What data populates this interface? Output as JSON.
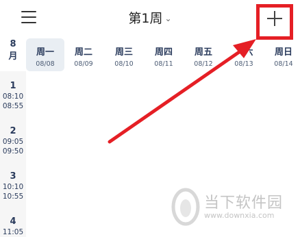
{
  "header": {
    "week_label": "第1周",
    "caret": "⌄",
    "menu_icon": "hamburger-menu-icon",
    "add_icon": "plus-icon",
    "highlight_color": "#e51f25"
  },
  "month": {
    "number": "8",
    "unit": "月"
  },
  "days": [
    {
      "name": "周一",
      "date": "08/08",
      "active": true
    },
    {
      "name": "周二",
      "date": "08/09",
      "active": false
    },
    {
      "name": "周三",
      "date": "08/10",
      "active": false
    },
    {
      "name": "周四",
      "date": "08/11",
      "active": false
    },
    {
      "name": "周五",
      "date": "08/12",
      "active": false
    },
    {
      "name": "六",
      "date": "08/13",
      "active": false
    },
    {
      "name": "周日",
      "date": "08/14",
      "active": false
    }
  ],
  "periods": [
    {
      "num": "1",
      "start": "08:10",
      "end": "08:55"
    },
    {
      "num": "2",
      "start": "09:05",
      "end": "09:50"
    },
    {
      "num": "3",
      "start": "10:10",
      "end": "10:55"
    },
    {
      "num": "4",
      "start": "11:05",
      "end": ""
    }
  ],
  "watermark": {
    "name": "当下软件园",
    "url": "www.downxia.com"
  }
}
